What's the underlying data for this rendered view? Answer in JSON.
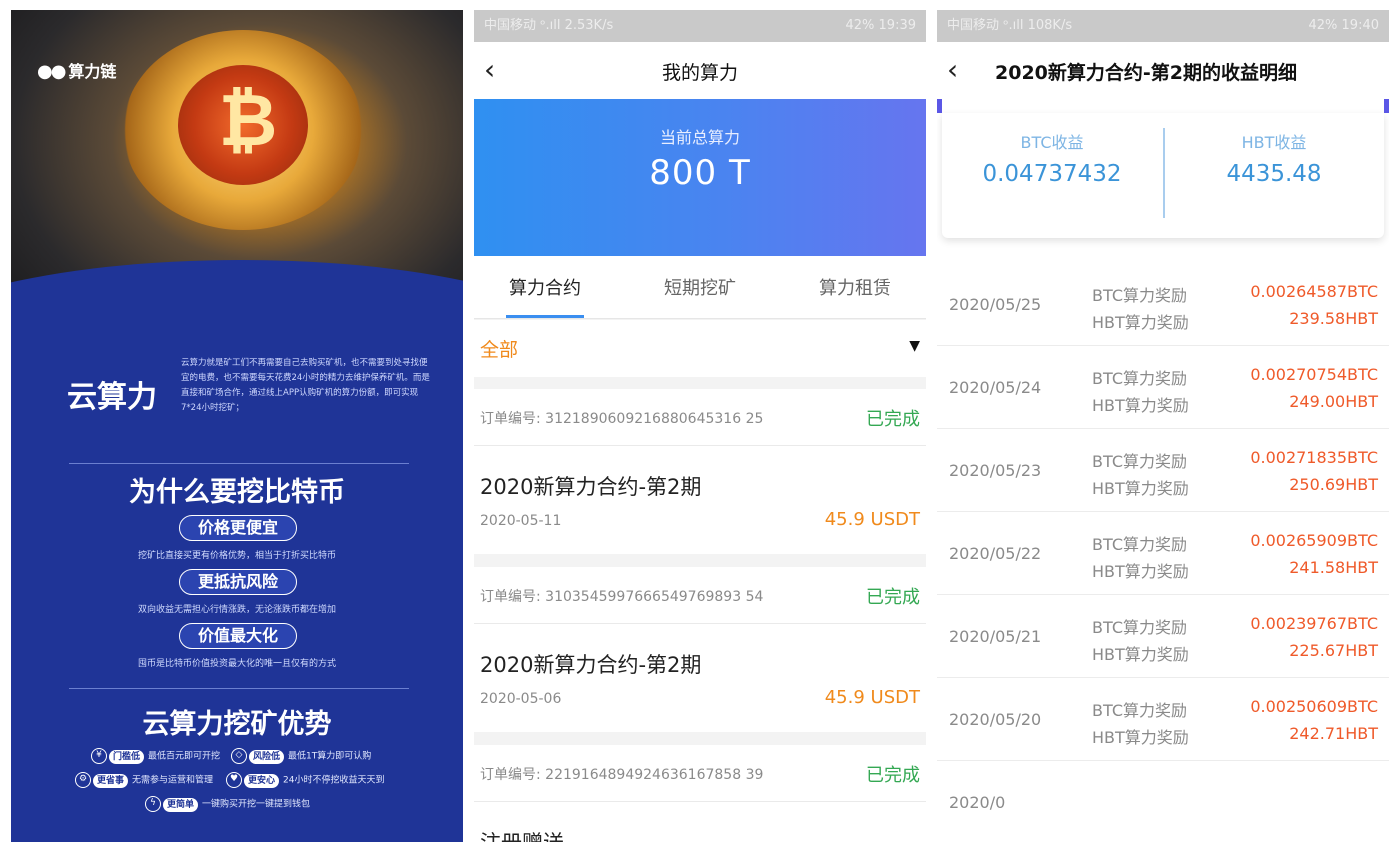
{
  "poster": {
    "logo_text": "算力链",
    "yun_title": "云算力",
    "yun_desc": "云算力就是矿工们不再需要自己去购买矿机，也不需要到处寻找便宜的电费，也不需要每天花费24小时的精力去维护保养矿机。而是直接和矿场合作，通过线上APP认购矿机的算力份额，即可实现7*24小时挖矿；",
    "why_title": "为什么要挖比特币",
    "reasons": [
      {
        "label": "价格更便宜",
        "desc": "挖矿比直接买更有价格优势，相当于打折买比特币"
      },
      {
        "label": "更抵抗风险",
        "desc": "双向收益无需担心行情涨跌，无论涨跌币都在增加"
      },
      {
        "label": "价值最大化",
        "desc": "囤币是比特币价值投资最大化的唯一且仅有的方式"
      }
    ],
    "adv_title": "云算力挖矿优势",
    "features": [
      {
        "tag": "门槛低",
        "desc": "最低百元即可开挖"
      },
      {
        "tag": "风险低",
        "desc": "最低1T算力即可认购"
      },
      {
        "tag": "更省事",
        "desc": "无需参与运营和管理"
      },
      {
        "tag": "更安心",
        "desc": "24小时不停挖收益天天到"
      },
      {
        "tag": "更简单",
        "desc": "一键购买开挖一键提到钱包"
      }
    ]
  },
  "screen2": {
    "status": {
      "left": "中国移动 ᵒ.ıll  2.53K/s",
      "right": "42%  19:39"
    },
    "title": "我的算力",
    "hero_label": "当前总算力",
    "hero_value": "800  T",
    "tabs": [
      "算力合约",
      "短期挖矿",
      "算力租赁"
    ],
    "filter": "全部",
    "orders": [
      {
        "order_no": "订单编号: 3121890609216880645316 25",
        "status": "已完成",
        "name": "2020新算力合约-第2期",
        "date": "2020-05-11",
        "price": "45.9 USDT"
      },
      {
        "order_no": "订单编号: 3103545997666549769893 54",
        "status": "已完成",
        "name": "2020新算力合约-第2期",
        "date": "2020-05-06",
        "price": "45.9 USDT"
      },
      {
        "order_no": "订单编号: 2219164894924636167858 39",
        "status": "已完成",
        "name": "注册赠送",
        "date": "",
        "price": ""
      }
    ]
  },
  "screen3": {
    "status": {
      "left": "中国移动 ᵒ.ıll  108K/s",
      "right": "42%  19:40"
    },
    "title": "2020新算力合约-第2期的收益明细",
    "btc_label": "BTC收益",
    "btc_value": "0.04737432",
    "hbt_label": "HBT收益",
    "hbt_value": "4435.48",
    "records": [
      {
        "date": "2020/05/25",
        "btc_name": "BTC算力奖励",
        "btc": "0.00264587BTC",
        "hbt_name": "HBT算力奖励",
        "hbt": "239.58HBT"
      },
      {
        "date": "2020/05/24",
        "btc_name": "BTC算力奖励",
        "btc": "0.00270754BTC",
        "hbt_name": "HBT算力奖励",
        "hbt": "249.00HBT"
      },
      {
        "date": "2020/05/23",
        "btc_name": "BTC算力奖励",
        "btc": "0.00271835BTC",
        "hbt_name": "HBT算力奖励",
        "hbt": "250.69HBT"
      },
      {
        "date": "2020/05/22",
        "btc_name": "BTC算力奖励",
        "btc": "0.00265909BTC",
        "hbt_name": "HBT算力奖励",
        "hbt": "241.58HBT"
      },
      {
        "date": "2020/05/21",
        "btc_name": "BTC算力奖励",
        "btc": "0.00239767BTC",
        "hbt_name": "HBT算力奖励",
        "hbt": "225.67HBT"
      },
      {
        "date": "2020/05/20",
        "btc_name": "BTC算力奖励",
        "btc": "0.00250609BTC",
        "hbt_name": "HBT算力奖励",
        "hbt": "242.71HBT"
      }
    ],
    "partial_date": "2020/0"
  }
}
